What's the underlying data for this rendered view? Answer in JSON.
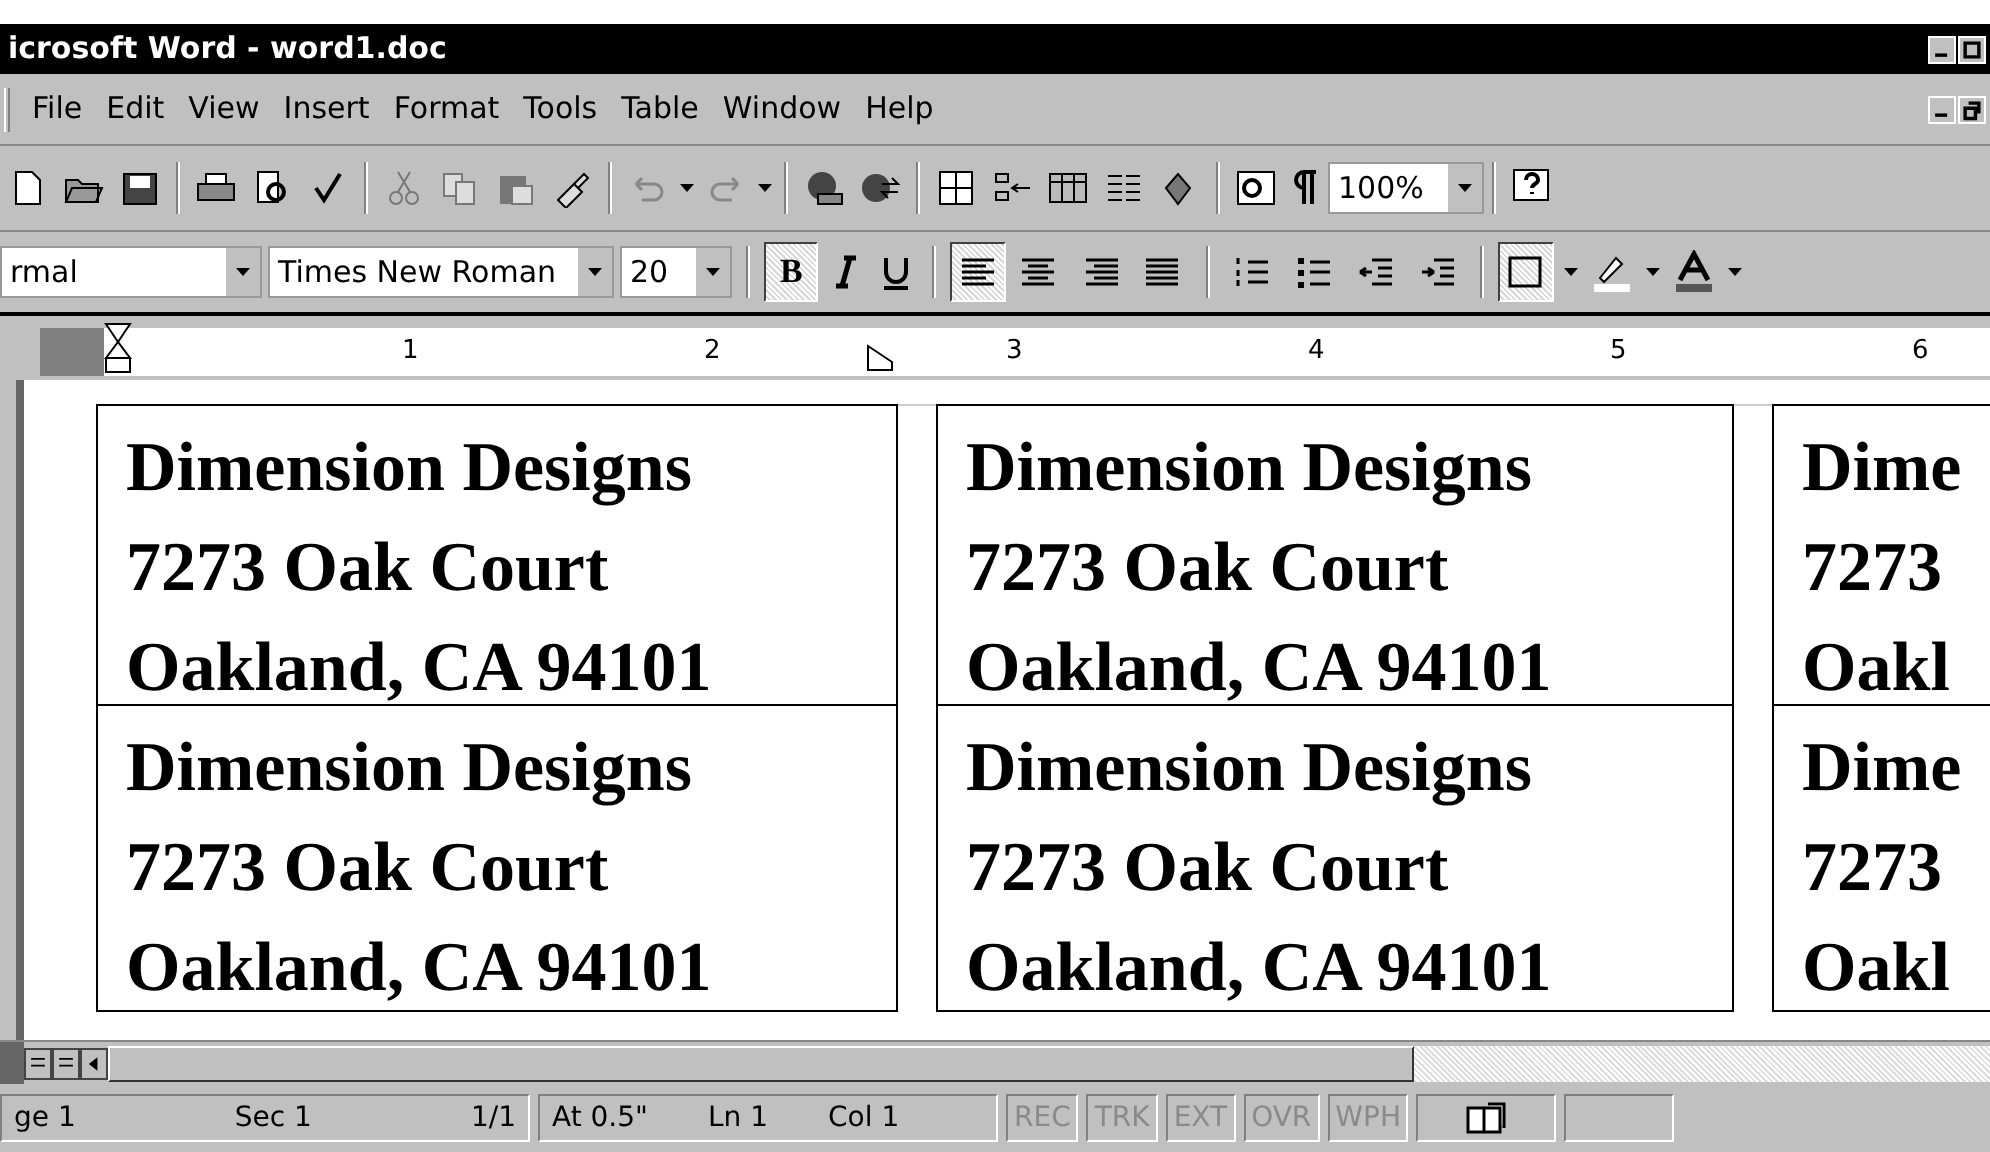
{
  "window": {
    "title": "icrosoft Word - word1.doc"
  },
  "menu": [
    "File",
    "Edit",
    "View",
    "Insert",
    "Format",
    "Tools",
    "Table",
    "Window",
    "Help"
  ],
  "standard_toolbar": {
    "zoom": "100%"
  },
  "formatting_toolbar": {
    "style": "rmal",
    "font": "Times New Roman",
    "size": "20",
    "bold": "B",
    "buttons": [
      {
        "pressed": true
      },
      {
        "pressed": true
      },
      {
        "pressed": false
      },
      {
        "pressed": false
      },
      {
        "pressed": false
      },
      {
        "pressed": false
      },
      {
        "pressed": false
      },
      {
        "pressed": false
      },
      {
        "pressed": false
      },
      {
        "pressed": true
      }
    ]
  },
  "ruler": {
    "numbers": [
      "1",
      "2",
      "3",
      "4",
      "5",
      "6"
    ]
  },
  "labels": [
    {
      "lines": [
        "Dimension Designs",
        "7273 Oak Court",
        "Oakland, CA 94101"
      ]
    },
    {
      "lines": [
        "Dimension Designs",
        "7273 Oak Court",
        "Oakland, CA 94101"
      ]
    },
    {
      "lines": [
        "Dime",
        "7273",
        "Oakl"
      ]
    },
    {
      "lines": [
        "Dimension Designs",
        "7273 Oak Court",
        "Oakland, CA 94101"
      ]
    },
    {
      "lines": [
        "Dimension Designs",
        "7273 Oak Court",
        "Oakland, CA 94101"
      ]
    },
    {
      "lines": [
        "Dime",
        "7273",
        "Oakl"
      ]
    }
  ],
  "status_bar": {
    "fields": [
      "ge 1",
      "Sec 1",
      "1/1",
      "At 0.5\"",
      "Ln 1",
      "Col 1"
    ],
    "modes": [
      {
        "label": "REC",
        "disabled": true
      },
      {
        "label": "TRK",
        "disabled": true
      },
      {
        "label": "EXT",
        "disabled": true
      },
      {
        "label": "OVR",
        "disabled": true
      },
      {
        "label": "WPH",
        "disabled": true
      }
    ]
  }
}
